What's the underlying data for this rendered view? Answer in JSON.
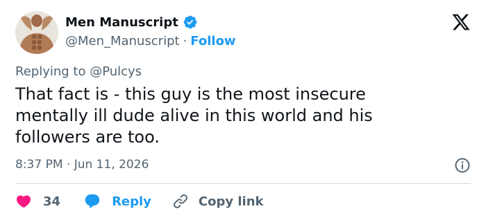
{
  "author": {
    "display_name": "Men Manuscript",
    "handle": "@Men_Manuscript",
    "separator": "·",
    "follow_label": "Follow",
    "verified": true
  },
  "tweet": {
    "replying_prefix": "Replying to",
    "replying_to": "@Pulcys",
    "text": "That fact is - this guy is the most insecure\nmentally ill dude alive in this world and his\nfollowers are too.",
    "timestamp": "8:37 PM · Jun 11, 2026"
  },
  "actions": {
    "like_count": "34",
    "reply_label": "Reply",
    "copy_label": "Copy link"
  },
  "colors": {
    "accent": "#1d9bf0",
    "like": "#f91880",
    "text": "#0f1419",
    "muted": "#536471",
    "divider": "#cfd9de"
  },
  "icons": {
    "brand": "x-logo-icon",
    "verified": "verified-badge-icon",
    "info": "info-icon",
    "like": "heart-icon",
    "reply": "speech-bubble-icon",
    "copy": "link-icon"
  }
}
